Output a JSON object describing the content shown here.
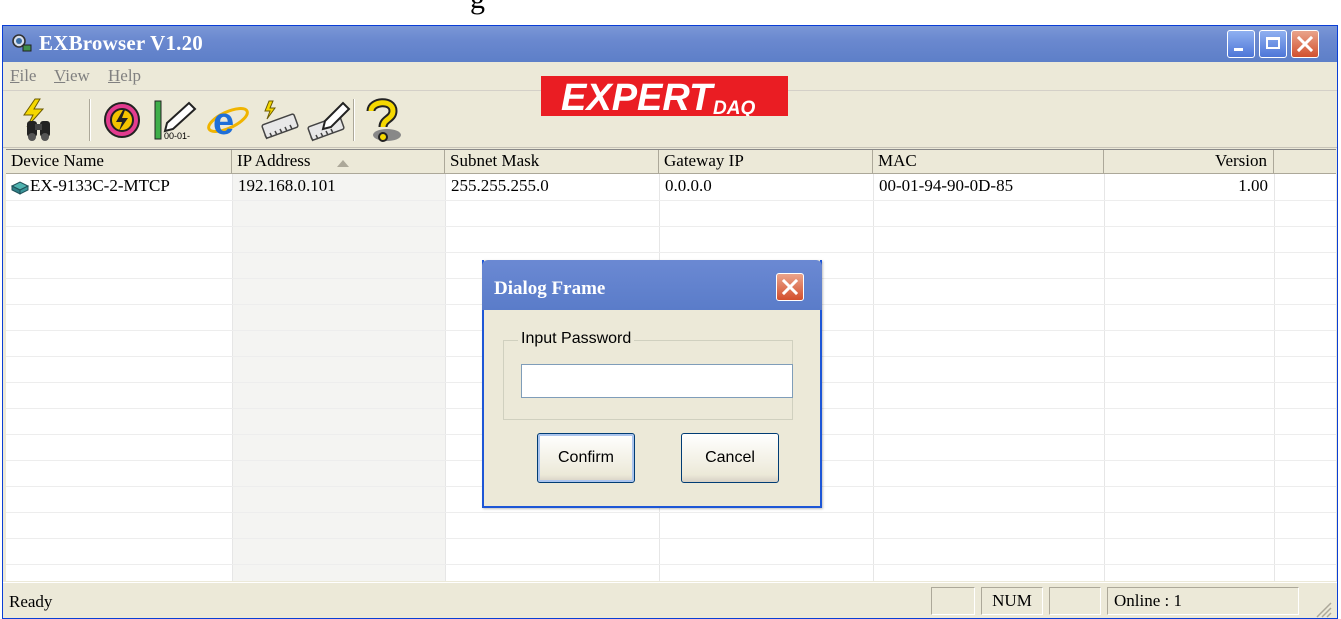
{
  "caption": "g",
  "window": {
    "title": "EXBrowser V1.20",
    "controls": {
      "minimize": "minimize-icon",
      "maximize": "maximize-icon",
      "close": "close-icon"
    }
  },
  "menu": [
    "File",
    "View",
    "Help"
  ],
  "toolbar": {
    "icons": [
      "search-devices-icon",
      "reset-icon",
      "set-address-icon",
      "web-browser-icon",
      "firmware-update-icon",
      "configure-icon",
      "help-icon"
    ],
    "logo_text": "EXPERT",
    "logo_sub": "DAQ",
    "logo_color": "#ea1d23"
  },
  "table": {
    "columns": [
      "Device Name",
      "IP Address",
      "Subnet Mask",
      "Gateway IP",
      "MAC",
      "Version"
    ],
    "sort_column": "IP Address",
    "rows": [
      {
        "device_name": "EX-9133C-2-MTCP",
        "ip": "192.168.0.101",
        "subnet": "255.255.255.0",
        "gateway": "0.0.0.0",
        "mac": "00-01-94-90-0D-85",
        "version": "1.00"
      }
    ]
  },
  "status": {
    "text": "Ready",
    "num": "NUM",
    "online": "Online : 1"
  },
  "dialog": {
    "title": "Dialog Frame",
    "group_label": "Input Password",
    "password_value": "",
    "confirm": "Confirm",
    "cancel": "Cancel"
  },
  "colors": {
    "titlebar": "#6a88cf",
    "close_button": "#d2502e",
    "logo": "#ea1d23"
  }
}
